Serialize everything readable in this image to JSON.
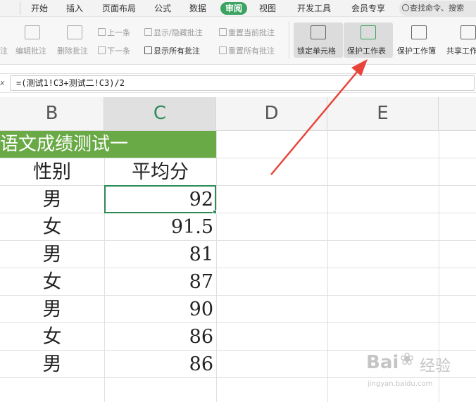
{
  "tabs": [
    "开始",
    "插入",
    "页面布局",
    "公式",
    "数据",
    "审阅",
    "视图",
    "开发工具",
    "会员专享"
  ],
  "active_tab": "审阅",
  "search": {
    "placeholder": "查找命令、搜索"
  },
  "ribbon": {
    "partial_left_label": "注",
    "edit_comment": "编辑批注",
    "delete_comment": "删除批注",
    "prev": "上一条",
    "next": "下一条",
    "show_hide": "显示/隐藏批注",
    "show_all": "显示所有批注",
    "reset_current": "重置当前批注",
    "reset_all": "重置所有批注",
    "lock_cell": "锁定单元格",
    "protect_sheet": "保护工作表",
    "protect_workbook": "保护工作簿",
    "share_workbook": "共享工作"
  },
  "formula_bar": {
    "fx": "x",
    "formula": "=(测试1!C3+测试二!C3)/2"
  },
  "columns": [
    "B",
    "C",
    "D",
    "E"
  ],
  "selected_column": "C",
  "sheet": {
    "title": "语文成绩测试一",
    "headers": [
      "性别",
      "平均分"
    ],
    "rows": [
      [
        "男",
        "92"
      ],
      [
        "女",
        "91.5"
      ],
      [
        "男",
        "81"
      ],
      [
        "女",
        "87"
      ],
      [
        "男",
        "90"
      ],
      [
        "女",
        "86"
      ],
      [
        "男",
        "86"
      ]
    ]
  },
  "watermark": {
    "brand": "Bai",
    "brand2": "经验",
    "url": "jingyan.baidu.com"
  },
  "colors": {
    "accent": "#3aa361",
    "title_fill": "#6aaa46",
    "selection": "#2e8b57",
    "arrow": "#e8443a"
  }
}
